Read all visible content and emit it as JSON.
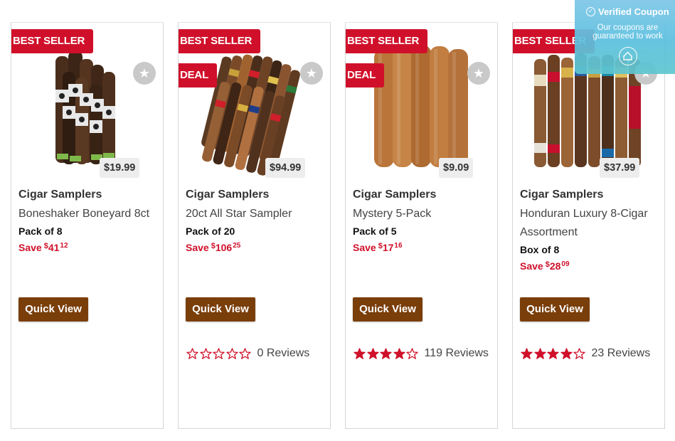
{
  "products": [
    {
      "badges": [
        "BEST SELLER"
      ],
      "price": "$19.99",
      "brand": "Cigar Samplers",
      "name": "Boneshaker Boneyard 8ct",
      "pack": "Pack of 8",
      "save_label": "Save",
      "save_currency": "$",
      "save_whole": "41",
      "save_cents": "12",
      "quick_view": "Quick View",
      "rating": null,
      "reviews": "",
      "image_icon": "cigar-bundle-dark"
    },
    {
      "badges": [
        "BEST SELLER",
        "DEAL"
      ],
      "price": "$94.99",
      "brand": "Cigar Samplers",
      "name": "20ct All Star Sampler",
      "pack": "Pack of 20",
      "save_label": "Save",
      "save_currency": "$",
      "save_whole": "106",
      "save_cents": "25",
      "quick_view": "Quick View",
      "rating": 0,
      "reviews": "0 Reviews",
      "image_icon": "cigar-assortment-fan"
    },
    {
      "badges": [
        "BEST SELLER",
        "DEAL"
      ],
      "price": "$9.09",
      "brand": "Cigar Samplers",
      "name": "Mystery 5-Pack",
      "pack": "Pack of 5",
      "save_label": "Save",
      "save_currency": "$",
      "save_whole": "17",
      "save_cents": "16",
      "quick_view": "Quick View",
      "rating": 4,
      "reviews": "119 Reviews",
      "image_icon": "cigar-bundle-light"
    },
    {
      "badges": [
        "BEST SELLER"
      ],
      "price": "$37.99",
      "brand": "Cigar Samplers",
      "name": "Honduran Luxury 8-Cigar Assortment",
      "pack": "Box of 8",
      "save_label": "Save",
      "save_currency": "$",
      "save_whole": "28",
      "save_cents": "09",
      "quick_view": "Quick View",
      "rating": 4,
      "reviews": "23 Reviews",
      "image_icon": "cigar-row-banded"
    }
  ],
  "coupon_popup": {
    "title": "Verified Coupon",
    "subtitle": "Our coupons are guaranteed to work"
  },
  "colors": {
    "badge_red": "#d0102a",
    "save_red": "#d0102a",
    "quick_view_brown": "#7a3e0a",
    "star_red": "#d0102a",
    "coupon_blue": "#5cc0df"
  }
}
